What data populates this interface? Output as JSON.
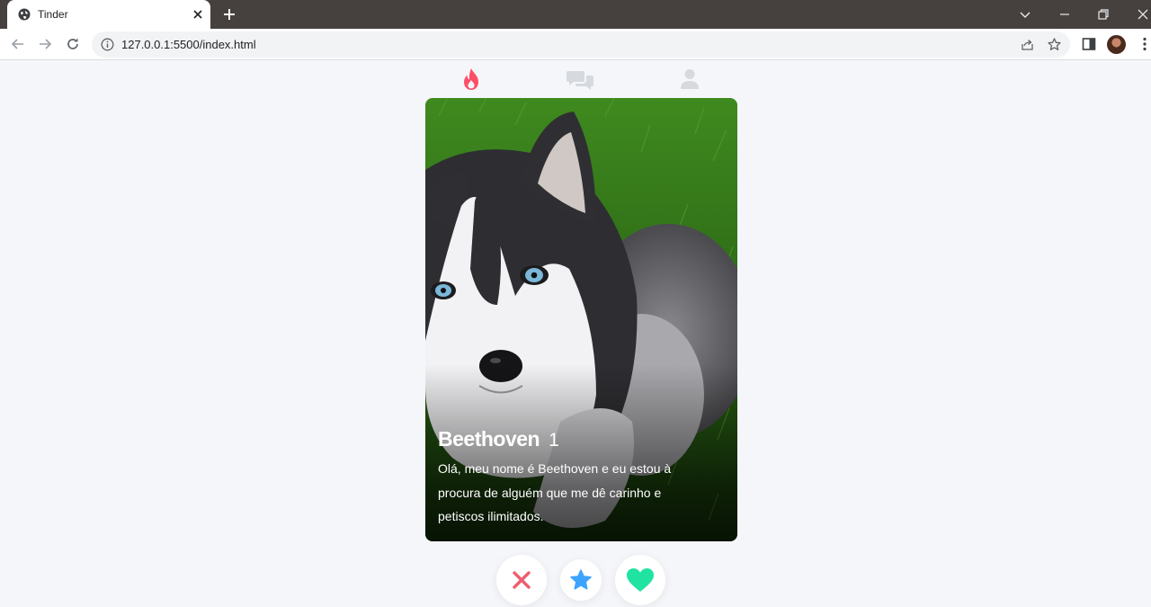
{
  "browser": {
    "tab_title": "Tinder",
    "url": "127.0.0.1:5500/index.html"
  },
  "app": {
    "nav": [
      {
        "icon": "flame-icon",
        "active": true
      },
      {
        "icon": "chat-icon",
        "active": false
      },
      {
        "icon": "user-icon",
        "active": false
      }
    ],
    "card": {
      "name": "Beethoven",
      "age": "1",
      "bio": "Olá, meu nome é Beethoven e eu estou à procura de alguém que me dê carinho e petiscos ilimitados."
    },
    "actions": [
      {
        "icon": "close-icon",
        "color": "#ec5e6f"
      },
      {
        "icon": "star-icon",
        "color": "#3ca4ff"
      },
      {
        "icon": "heart-icon",
        "color": "#20e3a2"
      }
    ]
  },
  "colors": {
    "flame_active": "#fd5068",
    "nav_inactive": "#d6d9de",
    "page_bg": "#f5f6f9",
    "tabbar_bg": "#46413e"
  }
}
